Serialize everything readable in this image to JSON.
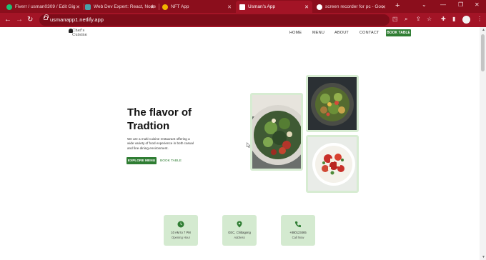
{
  "browser": {
    "tabs": [
      {
        "title": "Fiverr / usman0309 / Edit Gig",
        "favicon_color": "#1dbf73"
      },
      {
        "title": "Web Dev Expert: React, Node",
        "favicon_color": "#4aa0a8"
      },
      {
        "title": "NFT App",
        "favicon_color": "#f0b400"
      },
      {
        "title": "Usman's App",
        "favicon_color": "#ffffff",
        "active": true
      },
      {
        "title": "screen recorder for pc - Goo",
        "favicon_color": "#ffffff"
      }
    ],
    "new_tab": "+",
    "url": "usmanapp1.netlify.app",
    "accent_color": "#a31426"
  },
  "site": {
    "logo": {
      "line1": "Chef's",
      "line2": "Cuisine"
    },
    "nav": [
      "HOME",
      "MENU",
      "ABOUT",
      "CONTACT"
    ],
    "nav_button": "BOOK TABLE",
    "brand_color": "#2f7d33"
  },
  "hero": {
    "title_line1": "The flavor of",
    "title_line2": "Tradtion",
    "description": "We are a multi-cuisine restaurant offering a wide variety of food experience in both casual and fine dining environment.",
    "primary_button": "EXPLORE MENU",
    "secondary_button": "BOOK TABLE",
    "images": [
      "salad-plate",
      "salad-bowl",
      "tomato-feta-salad"
    ]
  },
  "info_cards": [
    {
      "icon": "clock-icon",
      "main": "10 AM to 7 PM",
      "sub": "Opening Hour"
    },
    {
      "icon": "location-pin-icon",
      "main": "GEC, Chittagong",
      "sub": "Address"
    },
    {
      "icon": "phone-icon",
      "main": "+880123465",
      "sub": "Call Now"
    }
  ]
}
